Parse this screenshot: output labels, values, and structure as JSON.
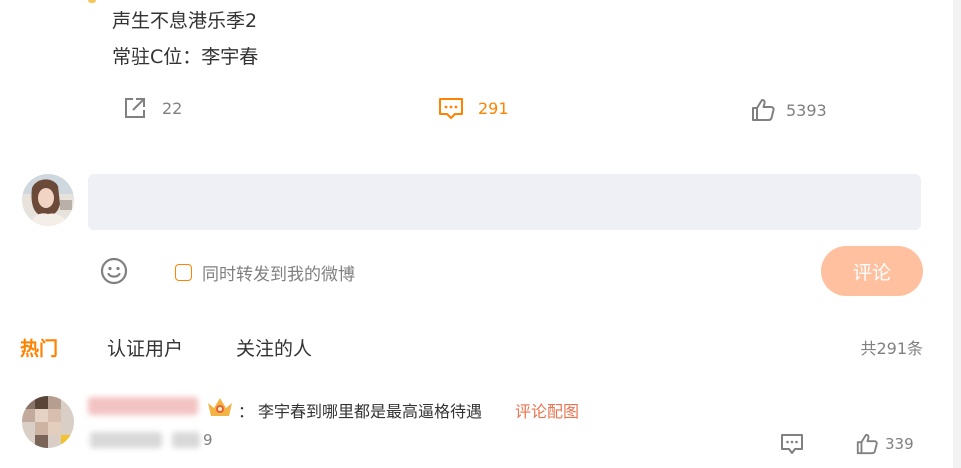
{
  "post": {
    "lines": [
      "声生不息港乐季2",
      "常驻C位：李宇春"
    ]
  },
  "actions": {
    "repost_count": "22",
    "comment_count": "291",
    "like_count": "5393",
    "icons": [
      "share-icon",
      "comment-icon",
      "like-icon"
    ]
  },
  "composer": {
    "input_value": "",
    "checkbox_label": "同时转发到我的微博",
    "submit_label": "评论",
    "emoji_icon": "emoji-icon"
  },
  "tabs": {
    "items": [
      "热门",
      "认证用户",
      "关注的人"
    ],
    "active": "热门",
    "total": "共291条"
  },
  "comments": [
    {
      "separator": "：",
      "text": "李宇春到哪里都是最高逼格待遇",
      "link": "评论配图",
      "meta_suffix": "9",
      "like_count": "339"
    }
  ],
  "colors": {
    "accent": "#ff8200",
    "submit_bg": "#ffc09f",
    "input_bg": "#eef0f5",
    "link": "#eb7350"
  }
}
